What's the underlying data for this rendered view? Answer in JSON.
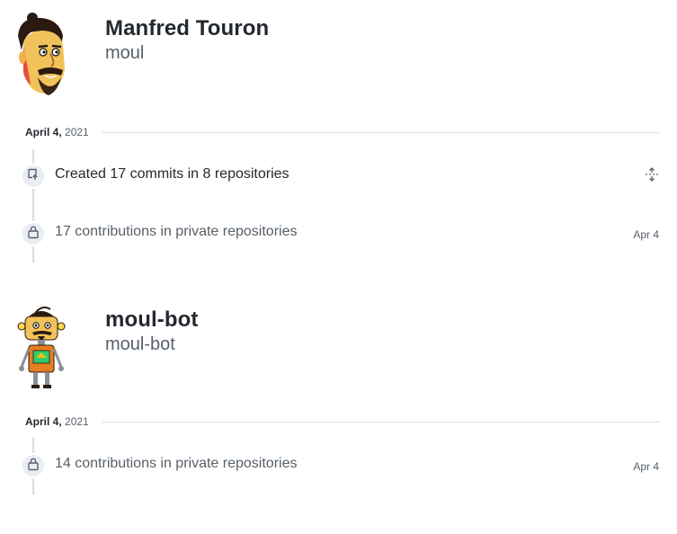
{
  "profiles": [
    {
      "name": "Manfred Touron",
      "login": "moul",
      "date_month_day": "April 4,",
      "date_year": "2021",
      "items": [
        {
          "text": "Created 17 commits in 8 repositories",
          "icon": "repo-push-icon",
          "action_icon": "unfold-icon"
        },
        {
          "text": "17 contributions in private repositories",
          "icon": "lock-icon",
          "date": "Apr 4"
        }
      ]
    },
    {
      "name": "moul-bot",
      "login": "moul-bot",
      "date_month_day": "April 4,",
      "date_year": "2021",
      "items": [
        {
          "text": "14 contributions in private repositories",
          "icon": "lock-icon",
          "date": "Apr 4"
        }
      ]
    }
  ],
  "colors": {
    "text": "#24292f",
    "muted": "#57606a",
    "border": "#d8dee4",
    "badge_bg": "#eaeef2"
  }
}
